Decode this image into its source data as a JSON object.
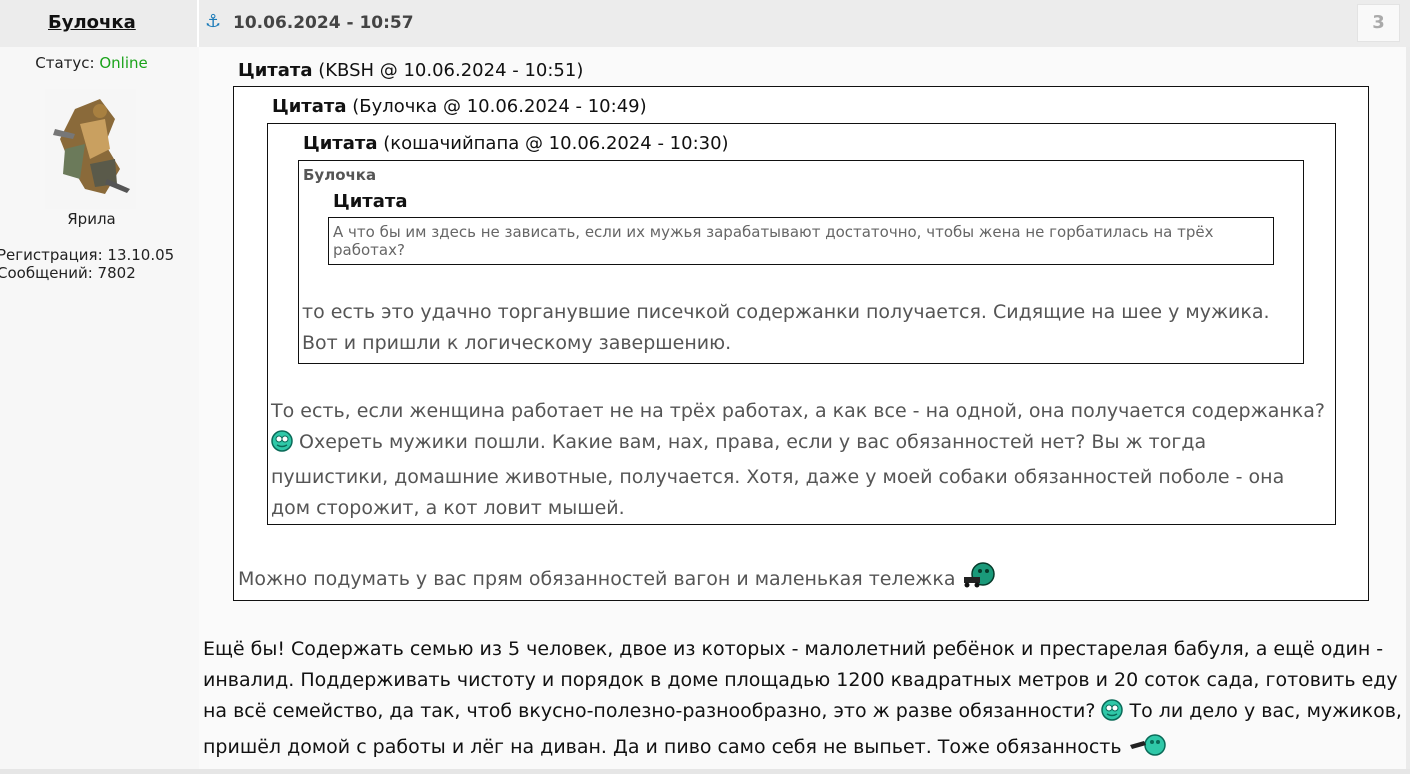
{
  "header": {
    "author": "Булочка",
    "post_date": "10.06.2024 - 10:57",
    "post_number": "3"
  },
  "user": {
    "status_label": "Статус: ",
    "status_value": "Online",
    "rank": "Ярила",
    "registration": "Регистрация: 13.10.05",
    "messages": "Сообщений: 7802"
  },
  "quote1": {
    "label": "Цитата",
    "meta": " (KBSH @ 10.06.2024 - 10:51)",
    "text": "Можно подумать у вас прям обязанностей вагон и маленькая тележка"
  },
  "quote2": {
    "label": "Цитата",
    "meta": " (Булочка @ 10.06.2024 - 10:49)",
    "text_a": "То есть, если женщина работает не на трёх работах, а как все - на одной, она получается содержанка? ",
    "text_b": " Охереть мужики пошли. Какие вам, нах, права, если у вас обязанностей нет? Вы ж тогда пушистики, домашние животные, получается. Хотя, даже у моей собаки обязанностей поболе - она дом сторожит, а кот ловит мышей."
  },
  "quote3": {
    "label": "Цитата",
    "meta": " (кошачийпапа @ 10.06.2024 - 10:30)",
    "text": "то есть это удачно торганувшие писечкой содержанки получается. Сидящие на шее у мужика. Вот и пришли к логическому завершению."
  },
  "quote4": {
    "author": "Булочка",
    "label": "Цитата",
    "text": "А что бы им здесь не зависать, если их мужья зарабатывают достаточно, чтобы жена не горбатилась на трёх работах?"
  },
  "post": {
    "text_a": "Ещё бы! Содержать семью из 5 человек, двое из которых - малолетний ребёнок и престарелая бабуля, а ещё один - инвалид. Поддерживать чистоту и порядок в доме площадью 1200 квадратных метров и 20 соток сада, готовить еду на всё семейство, да так, чтоб вкусно-полезно-разнообразно, это ж разве обязанности? ",
    "text_b": " То ли дело у вас, мужиков, пришёл домой с работы и лёг на диван. Да и пиво само себя не выпьет. Тоже обязанность "
  },
  "icons": [
    "anchor-icon",
    "user-avatar",
    "smiley-icon",
    "smiley-cart-icon"
  ]
}
